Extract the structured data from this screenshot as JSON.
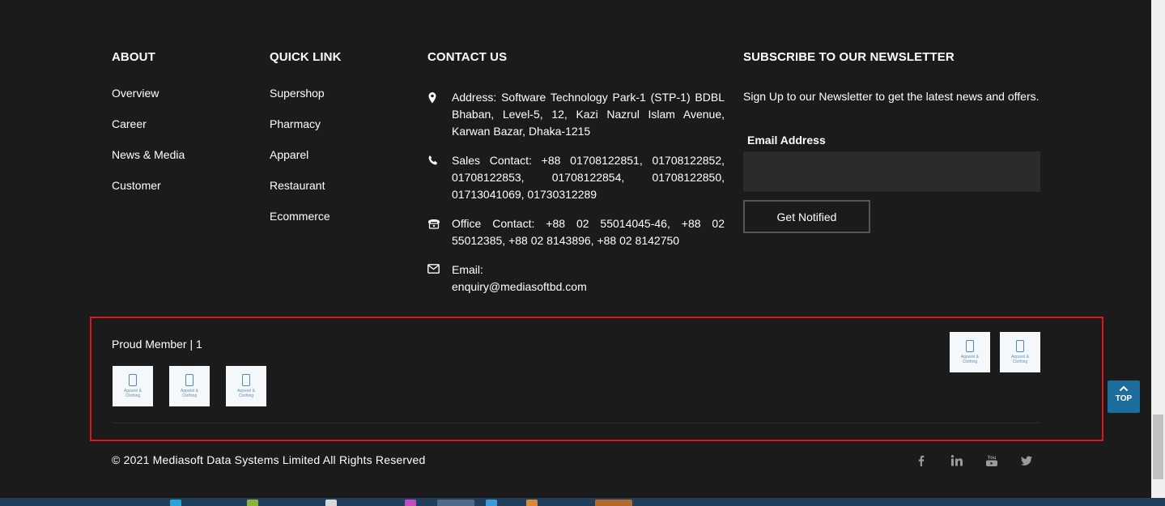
{
  "about": {
    "title": "ABOUT",
    "links": [
      "Overview",
      "Career",
      "News & Media",
      "Customer"
    ]
  },
  "quick_link": {
    "title": "QUICK LINK",
    "links": [
      "Supershop",
      "Pharmacy",
      "Apparel",
      "Restaurant",
      "Ecommerce"
    ]
  },
  "contact": {
    "title": "CONTACT US",
    "address": "Address: Software Technology Park-1 (STP-1) BDBL Bhaban, Level-5, 12, Kazi Nazrul Islam Avenue, Karwan Bazar, Dhaka-1215",
    "sales": "Sales Contact: +88 01708122851, 01708122852, 01708122853, 01708122854, 01708122850, 01713041069, 01730312289",
    "office": "Office Contact: +88 02 55014045-46, +88 02 55012385, +88 02 8143896, +88 02 8142750",
    "email_label": "Email:",
    "email_value": "enquiry@mediasoftbd.com"
  },
  "newsletter": {
    "title": "SUBSCRIBE TO OUR NEWSLETTER",
    "text": "Sign Up to our Newsletter to get the latest news and offers.",
    "email_label": "Email Address",
    "email_value": "",
    "button_label": "Get Notified"
  },
  "members": {
    "title": "Proud Member | 1",
    "logo_caption": "Apparel & Clothing"
  },
  "copyright": "© 2021 Mediasoft Data Systems Limited All Rights Reserved",
  "social_icons": [
    "facebook-icon",
    "linkedin-icon",
    "youtube-icon",
    "twitter-icon"
  ],
  "top_button": {
    "label": "TOP"
  },
  "colors": {
    "background": "#1b1b1b",
    "input_background": "#2b2b2b",
    "highlight_border": "#e0141b",
    "top_button": "#1d6d9c",
    "icon_gray": "#9a9a9a"
  }
}
